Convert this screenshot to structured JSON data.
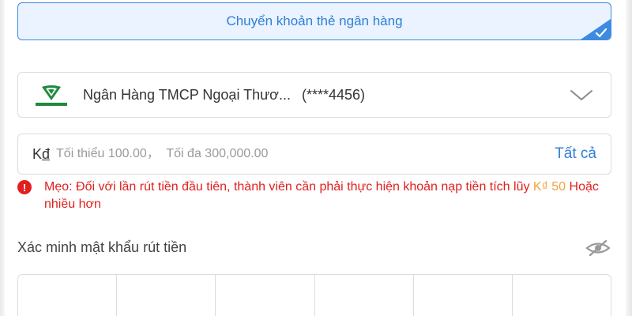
{
  "method_tab": {
    "label": "Chuyển khoản thẻ ngân hàng",
    "selected": true
  },
  "bank_select": {
    "logo_icon": "vietcombank-logo-icon",
    "bank_name": "Ngân Hàng TMCP Ngoại Thươ...",
    "account_masked": "(****4456)",
    "dropdown_icon": "chevron-down-icon"
  },
  "amount": {
    "currency_prefix": "K",
    "currency_suffix": "đ",
    "placeholder": "Tối thiểu 100.00，  Tối đa 300,000.00",
    "value": "",
    "all_label": "Tất cả"
  },
  "tip": {
    "icon": "exclamation-icon",
    "text_before": "Mẹo: Đối với lần rút tiền đầu tiên, thành viên cần phải thực hiện khoản nạp tiền tích lũy ",
    "amount_currency": "K₫",
    "amount_value": "50",
    "text_after": " Hoặc nhiều hơn"
  },
  "password": {
    "label": "Xác minh mật khẩu rút tiền",
    "visibility_icon": "eye-slash-icon",
    "pin_cells": [
      "",
      "",
      "",
      "",
      "",
      ""
    ]
  },
  "colors": {
    "accent": "#2f7fd6",
    "tab_border": "#3d8be0",
    "tab_bg": "#eaf3ff",
    "warning": "#e0201f",
    "highlight": "#f3a33b",
    "vcb_green": "#1f8a3b"
  }
}
